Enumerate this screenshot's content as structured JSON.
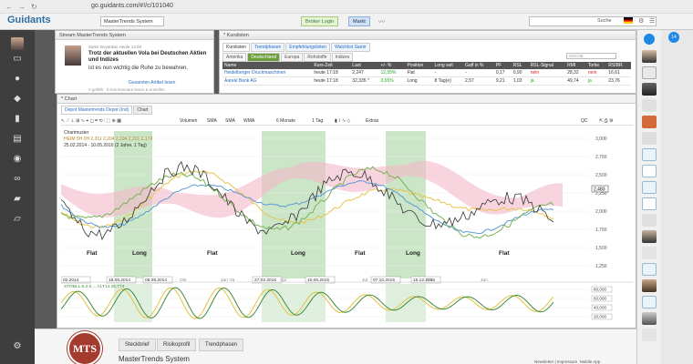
{
  "browser": {
    "url": "go.guidants.com/#!/c/101040",
    "back": "←",
    "forward": "→",
    "reload": "↻"
  },
  "app": {
    "logo": "Guidants",
    "tab": "MasterTrends System",
    "broker_button": "Broker Login",
    "markt_button": "Markt",
    "search_label": "Suche"
  },
  "stream": {
    "panel_title": "Stream MasterTrends System",
    "author": "Samir Boyardan  Heute 13:00",
    "title": "Trotz der aktuellen Vola bei Deutschen Aktien und Indizes",
    "subtitle": "ist es nun wichtig die Ruhe zu bewahren.",
    "link": "Gesamten Artikel lesen",
    "footer": "0 gefällt · 0 Kommentare lesen & erstellen"
  },
  "kurslisten": {
    "panel_title": "* Kurslisten",
    "tabs": [
      "Kurslisten",
      "Trendphasen",
      "Empfehlungslisten",
      "Watchlist Samir"
    ],
    "subtabs": [
      "Amerika",
      "Deutschland",
      "Europa",
      "Rohstoffe",
      "Indizes"
    ],
    "search_placeholder": "SUCHE",
    "headers": [
      "Name",
      "Kurs-Zeit",
      "Last",
      "+/- %",
      "Position",
      "Long seit",
      "Gaff in %",
      "PF",
      "RSL",
      "RSL-Signal",
      "RMI",
      "Tortie",
      "RSIBR"
    ],
    "rows": [
      [
        "Heidelberger Druckmaschinen",
        "heute 17:18",
        "2,247",
        "12,55%",
        "Flat",
        "-",
        "-",
        "0,17",
        "0,90",
        "nein",
        "28,32",
        "nein",
        "16,61"
      ],
      [
        "Aareal Bank AG",
        "heute 17:18",
        "32,335 *",
        "0,65%",
        "Long",
        "8 Tag(e)",
        "2,57",
        "9,21",
        "1,03",
        "ja",
        "49,74",
        "ja",
        "23,76"
      ]
    ]
  },
  "chart": {
    "panel_title": "* Chart",
    "tabs": [
      "Depot Mastertrends Depot (Ind)",
      "Chart"
    ],
    "toolbar": [
      "Volumen",
      "SMA",
      "SMA",
      "WMA",
      "6 Monate",
      "1 Tag",
      "Extras",
      "QC"
    ],
    "legend1": "Chartmuster",
    "legend2": "HEIM 5H 0H 2,311   2,204  2,194  2,201  2,174",
    "legend3": "25.02.2014 - 10.05.2016 (2 Jahre, 1 Tag)",
    "osc_legend": "STOBLL 5,3 5 ... ALT14   25,774",
    "phase_labels": [
      "Flat",
      "Long",
      "Flat",
      "Long",
      "Flat",
      "Long",
      "Flat"
    ],
    "date_labels": [
      "02.2014",
      "18.06.2014",
      "08.09.2014",
      "27.02.2015",
      "10.06.2015",
      "07.10.2015",
      "15.12.2015"
    ],
    "axis_months": [
      "Okt",
      "Jan '15",
      "Apr",
      "Jul",
      "Okt",
      "Jan"
    ],
    "y_ticks": [
      "3,000",
      "2,750",
      "2,500",
      "2,250",
      "2,000",
      "1,750",
      "1,500",
      "1,250"
    ],
    "y_marker": "2,483",
    "osc_ticks": [
      "80,000",
      "60,000",
      "40,000",
      "20,000"
    ]
  },
  "chart_data": {
    "type": "line",
    "title": "",
    "xlabel": "",
    "ylabel": "",
    "ylim": [
      1250,
      3050
    ],
    "series": [
      {
        "name": "Chartmuster",
        "color": "#222222"
      }
    ]
  },
  "bottom": {
    "logo_text": "MTS",
    "tabs": [
      "Steckbrief",
      "Risikoprofil",
      "Trendphasen"
    ],
    "title": "MasterTrends System",
    "newsletter": "Newsletter | Impressum",
    "mobile": "Mobile App"
  },
  "colors": {
    "long_phase": "#b9dcb4",
    "cloud_pink": "#f3b7c8",
    "cloud_green": "#c5e3bd",
    "accent": "#2e6da4"
  }
}
